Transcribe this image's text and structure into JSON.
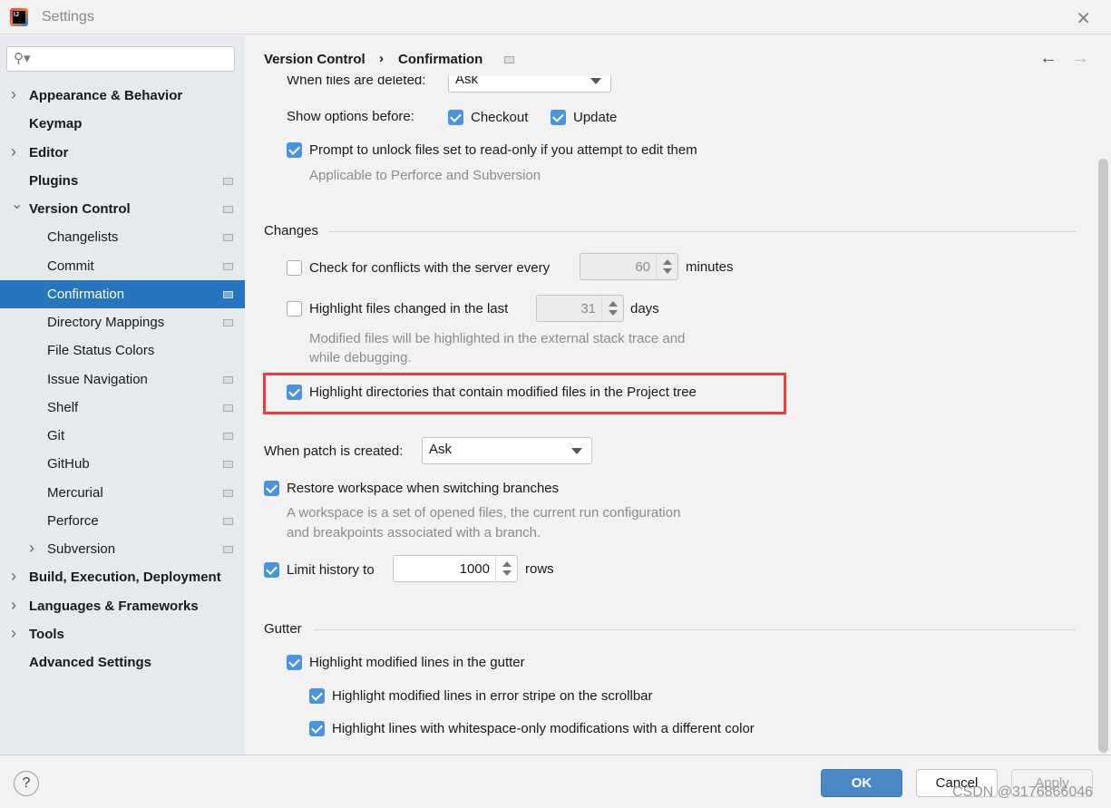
{
  "window": {
    "title": "Settings",
    "close_icon": "close-icon"
  },
  "sidebar": {
    "search_placeholder": "",
    "items": [
      {
        "label": "Appearance & Behavior",
        "level": 0,
        "bold": true,
        "arrow": "right"
      },
      {
        "label": "Keymap",
        "level": 0,
        "bold": true
      },
      {
        "label": "Editor",
        "level": 0,
        "bold": true,
        "arrow": "right"
      },
      {
        "label": "Plugins",
        "level": 0,
        "bold": true,
        "project_icon": true
      },
      {
        "label": "Version Control",
        "level": 0,
        "bold": true,
        "arrow": "down",
        "project_icon": true
      },
      {
        "label": "Changelists",
        "level": 1,
        "project_icon": true
      },
      {
        "label": "Commit",
        "level": 1,
        "project_icon": true
      },
      {
        "label": "Confirmation",
        "level": 1,
        "project_icon": true,
        "selected": true
      },
      {
        "label": "Directory Mappings",
        "level": 1,
        "project_icon": true
      },
      {
        "label": "File Status Colors",
        "level": 1
      },
      {
        "label": "Issue Navigation",
        "level": 1,
        "project_icon": true
      },
      {
        "label": "Shelf",
        "level": 1,
        "project_icon": true
      },
      {
        "label": "Git",
        "level": 1,
        "project_icon": true
      },
      {
        "label": "GitHub",
        "level": 1,
        "project_icon": true
      },
      {
        "label": "Mercurial",
        "level": 1,
        "project_icon": true
      },
      {
        "label": "Perforce",
        "level": 1,
        "project_icon": true
      },
      {
        "label": "Subversion",
        "level": 1,
        "arrow": "right",
        "project_icon": true
      },
      {
        "label": "Build, Execution, Deployment",
        "level": 0,
        "bold": true,
        "arrow": "right"
      },
      {
        "label": "Languages & Frameworks",
        "level": 0,
        "bold": true,
        "arrow": "right"
      },
      {
        "label": "Tools",
        "level": 0,
        "bold": true,
        "arrow": "right"
      },
      {
        "label": "Advanced Settings",
        "level": 0,
        "bold": true
      }
    ]
  },
  "breadcrumb": {
    "parent": "Version Control",
    "sep": "›",
    "current": "Confirmation"
  },
  "content": {
    "deleted_label": "When files are deleted:",
    "deleted_value": "Ask",
    "show_options_label": "Show options before:",
    "checkout": "Checkout",
    "update": "Update",
    "prompt_unlock": "Prompt to unlock files set to read-only if you attempt to edit them",
    "prompt_unlock_hint": "Applicable to Perforce and Subversion",
    "changes_header": "Changes",
    "check_conflicts": "Check for conflicts with the server every",
    "conflicts_value": "60",
    "minutes": "minutes",
    "highlight_changed": "Highlight files changed in the last",
    "changed_value": "31",
    "days": "days",
    "changed_hint1": "Modified files will be highlighted in the external stack trace and",
    "changed_hint2": "while debugging.",
    "highlight_dirs": "Highlight directories that contain modified files in the Project tree",
    "patch_label": "When patch is created:",
    "patch_value": "Ask",
    "restore_ws": "Restore workspace when switching branches",
    "restore_hint1": "A workspace is a set of opened files, the current run configuration",
    "restore_hint2": "and breakpoints associated with a branch.",
    "limit_history": "Limit history to",
    "history_value": "1000",
    "rows": "rows",
    "gutter_header": "Gutter",
    "gutter_lines": "Highlight modified lines in the gutter",
    "gutter_stripe": "Highlight modified lines in error stripe on the scrollbar",
    "gutter_whitespace": "Highlight lines with whitespace-only modifications with a different color"
  },
  "footer": {
    "help": "?",
    "ok": "OK",
    "cancel": "Cancel",
    "apply": "Apply",
    "watermark": "CSDN @3176866046"
  },
  "colors": {
    "accent": "#2675bf",
    "checkbox": "#4a93dd",
    "highlight_box": "#ef3b3b"
  }
}
